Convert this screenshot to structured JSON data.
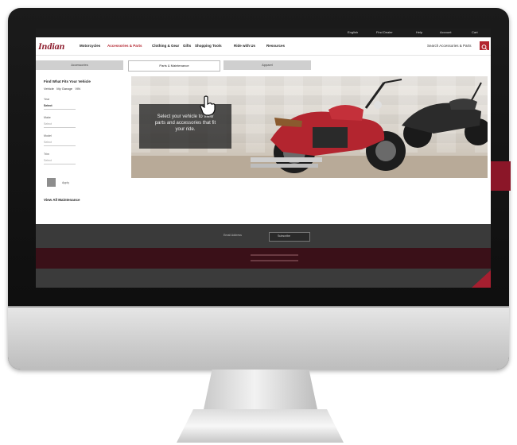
{
  "utility_bar": {
    "items": [
      "English",
      "Find Dealer",
      "Help",
      "Account",
      "Cart"
    ]
  },
  "brand": {
    "logo": "Indian"
  },
  "nav": {
    "items": [
      "Motorcycles",
      "Accessories & Parts",
      "Clothing & Gear",
      "Gifts",
      "Shopping Tools",
      "Ride with Us",
      "Resources"
    ],
    "search_placeholder": "Search Accessories & Parts"
  },
  "tabs": [
    "Accessories",
    "Parts & Maintenance",
    "Apparel"
  ],
  "sidebar": {
    "title": "Find What Fits Your Vehicle",
    "links": [
      "Vehicle",
      "My Garage",
      "VIN"
    ],
    "fields": [
      {
        "label": "Year",
        "value": "Select"
      },
      {
        "label": "Make",
        "value": "Select"
      },
      {
        "label": "Model",
        "value": "Select"
      },
      {
        "label": "Trim",
        "value": "Select"
      }
    ],
    "go_label": "Apply",
    "view_all": "View All Maintenance"
  },
  "hero": {
    "message_line1": "Select your vehicle to view",
    "message_line2": "parts and accessories that fit",
    "message_line3": "your ride."
  },
  "footer": {
    "left_text": "Email Address",
    "button_label": "Subscribe"
  },
  "colors": {
    "brand_red": "#b3252f",
    "accent_maroon": "#8b1628",
    "footer_dark": "#3a3a3a",
    "footer_maroon": "#3a1018"
  }
}
